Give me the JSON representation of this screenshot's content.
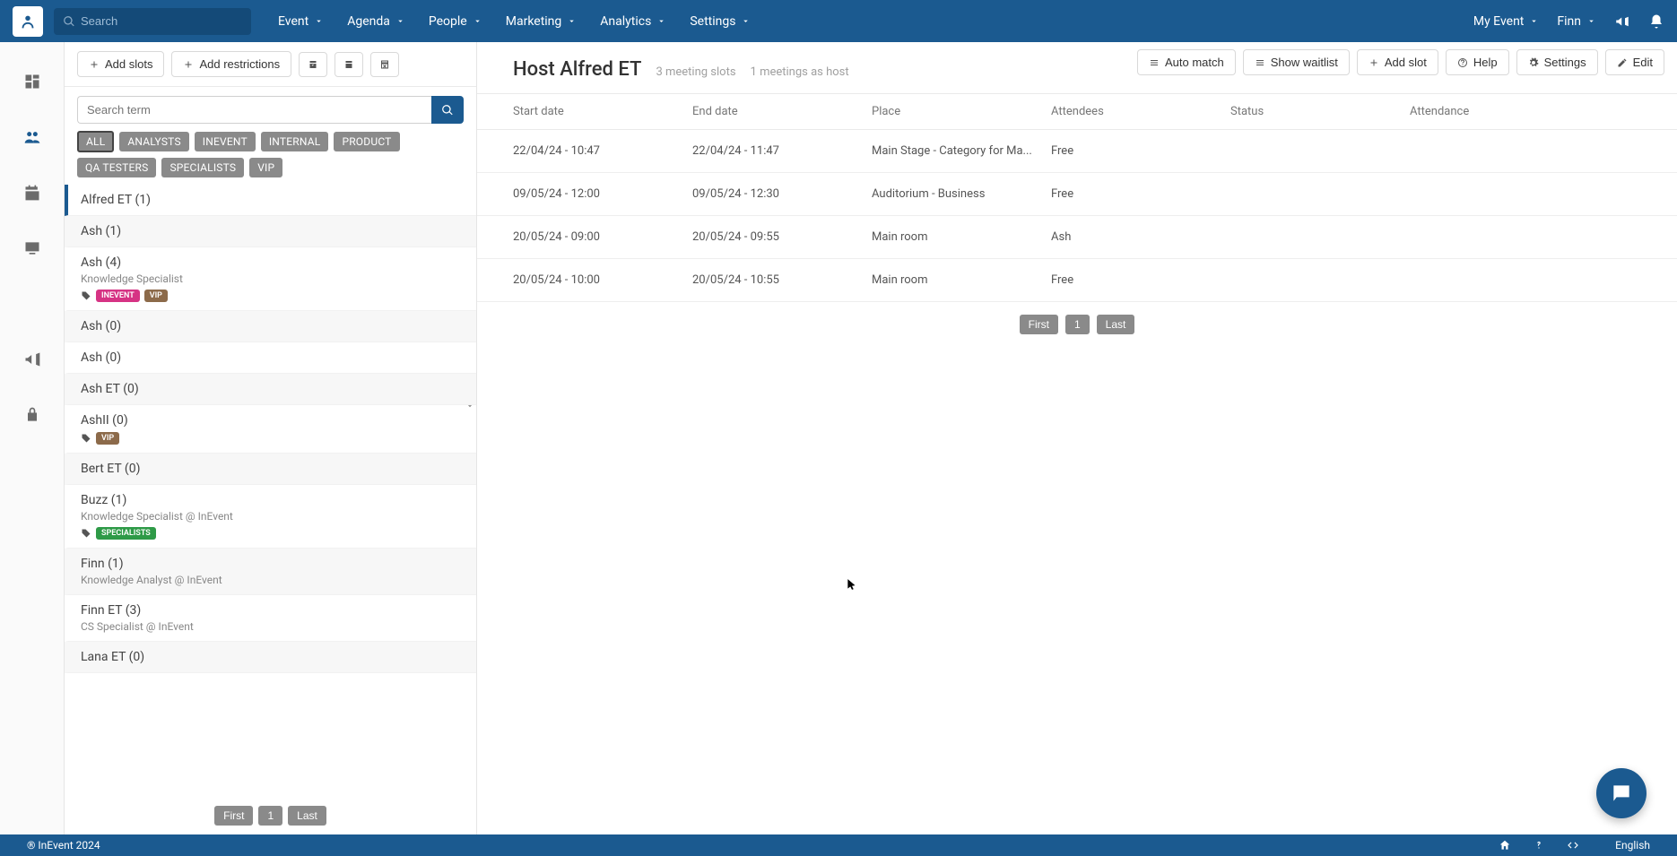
{
  "top": {
    "search_placeholder": "Search",
    "menus": [
      "Event",
      "Agenda",
      "People",
      "Marketing",
      "Analytics",
      "Settings"
    ],
    "event_sel": "My Event",
    "user": "Finn"
  },
  "toolbar": {
    "add_slots": "Add slots",
    "add_restrictions": "Add restrictions",
    "auto_match": "Auto match",
    "show_waitlist": "Show waitlist",
    "add_slot": "Add slot",
    "help": "Help",
    "settings": "Settings",
    "edit": "Edit"
  },
  "left": {
    "search_placeholder": "Search term",
    "filters": [
      "ALL",
      "ANALYSTS",
      "INEVENT",
      "INTERNAL",
      "PRODUCT",
      "QA TESTERS",
      "SPECIALISTS",
      "VIP"
    ],
    "people": [
      {
        "name": "Alfred ET (1)",
        "active": true
      },
      {
        "name": "Ash (1)"
      },
      {
        "name": "Ash (4)",
        "sub": "Knowledge Specialist",
        "tags": [
          {
            "t": "INEVENT",
            "c": "#d63384"
          },
          {
            "t": "VIP",
            "c": "#8c6a4a"
          }
        ]
      },
      {
        "name": "Ash (0)"
      },
      {
        "name": "Ash (0)"
      },
      {
        "name": "Ash ET (0)"
      },
      {
        "name": "AshII (0)",
        "tags": [
          {
            "t": "VIP",
            "c": "#8c6a4a"
          }
        ]
      },
      {
        "name": "Bert ET (0)"
      },
      {
        "name": "Buzz (1)",
        "sub": "Knowledge Specialist @ InEvent",
        "tags": [
          {
            "t": "SPECIALISTS",
            "c": "#2e9a47"
          }
        ]
      },
      {
        "name": "Finn (1)",
        "sub": "Knowledge Analyst @ InEvent"
      },
      {
        "name": "Finn ET (3)",
        "sub": "CS Specialist @ InEvent"
      },
      {
        "name": "Lana ET (0)"
      }
    ],
    "pager": {
      "first": "First",
      "page": "1",
      "last": "Last"
    }
  },
  "right": {
    "title": "Host Alfred ET",
    "sub1": "3 meeting slots",
    "sub2": "1 meetings as host",
    "columns": [
      "Start date",
      "End date",
      "Place",
      "Attendees",
      "Status",
      "Attendance"
    ],
    "rows": [
      {
        "start": "22/04/24 - 10:47",
        "end": "22/04/24 - 11:47",
        "place": "Main Stage - Category for Ma...",
        "att": "Free"
      },
      {
        "start": "09/05/24 - 12:00",
        "end": "09/05/24 - 12:30",
        "place": "Auditorium - Business",
        "att": "Free"
      },
      {
        "start": "20/05/24 - 09:00",
        "end": "20/05/24 - 09:55",
        "place": "Main room",
        "att": "Ash"
      },
      {
        "start": "20/05/24 - 10:00",
        "end": "20/05/24 - 10:55",
        "place": "Main room",
        "att": "Free"
      }
    ],
    "pager": {
      "first": "First",
      "page": "1",
      "last": "Last"
    }
  },
  "footer": {
    "copyright": "® InEvent 2024",
    "lang": "English"
  }
}
